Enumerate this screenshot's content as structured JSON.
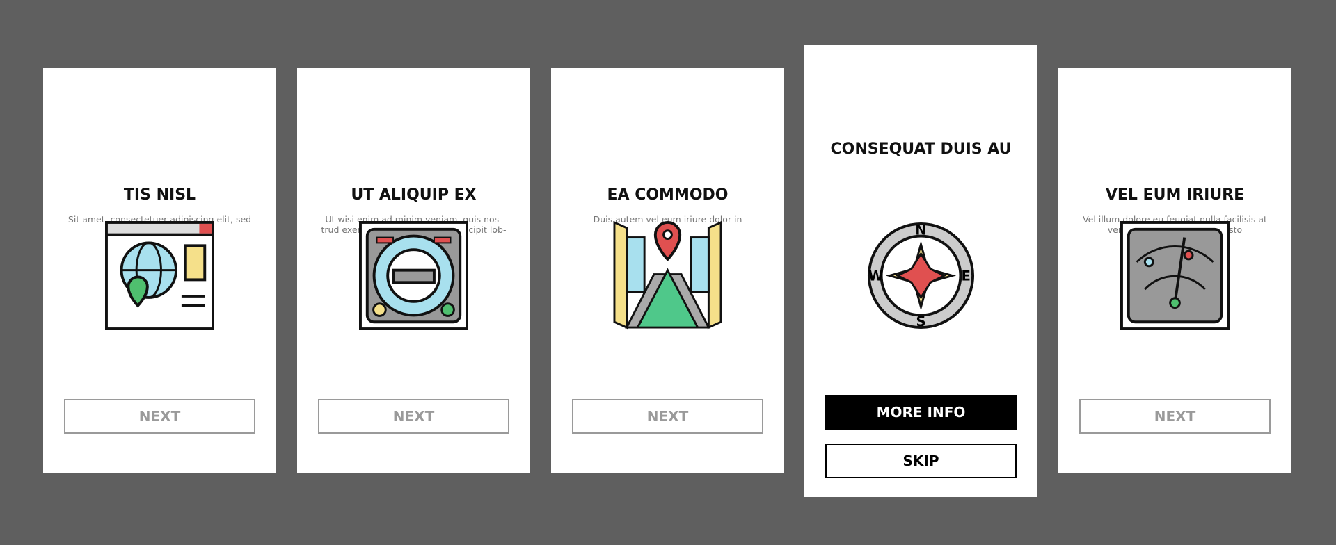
{
  "cards": [
    {
      "title": "TIS NISL",
      "description": "Sit amet, consectetuer adipiscing elit, sed diam",
      "icon": "web-map-globe-icon",
      "button": "NEXT"
    },
    {
      "title": "UT ALIQUIP EX",
      "description": "Ut wisi enim ad minim veniam, quis nos-trud exerci tation ullamcorper suscipit lob-ortis",
      "icon": "aircraft-instrument-icon",
      "button": "NEXT"
    },
    {
      "title": "EA COMMODO",
      "description": "Duis autem vel eum iriure dolor in",
      "icon": "street-location-pin-icon",
      "button": "NEXT"
    },
    {
      "title": "CONSEQUAT DUIS AU",
      "description": "",
      "icon": "compass-icon",
      "primary_button": "MORE INFO",
      "secondary_button": "SKIP",
      "compass": {
        "n": "N",
        "e": "E",
        "s": "S",
        "w": "W"
      }
    },
    {
      "title": "VEL EUM IRIURE",
      "description": "Vel illum dolore eu feugiat nulla facilisis at vero eros et accumsan et iusto",
      "icon": "radar-icon",
      "button": "NEXT"
    }
  ]
}
